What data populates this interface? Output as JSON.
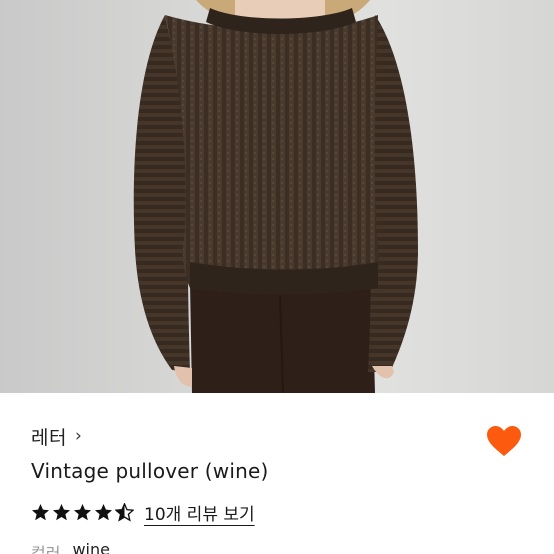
{
  "product": {
    "brand": "레터",
    "brand_chevron": "›",
    "title": "Vintage pullover (wine)",
    "rating": 4.5,
    "rating_max": 5,
    "review_link": "10개 리뷰 보기",
    "color_label": "컬러",
    "color_value": "wine"
  },
  "icons": {
    "favorite": "heart-icon",
    "star": "star-icon",
    "chevron": "chevron-right-icon"
  },
  "colors": {
    "accent": "#fb5a0f",
    "sweater": "#3a2d24",
    "pants": "#2e2019",
    "star": "#111111"
  }
}
